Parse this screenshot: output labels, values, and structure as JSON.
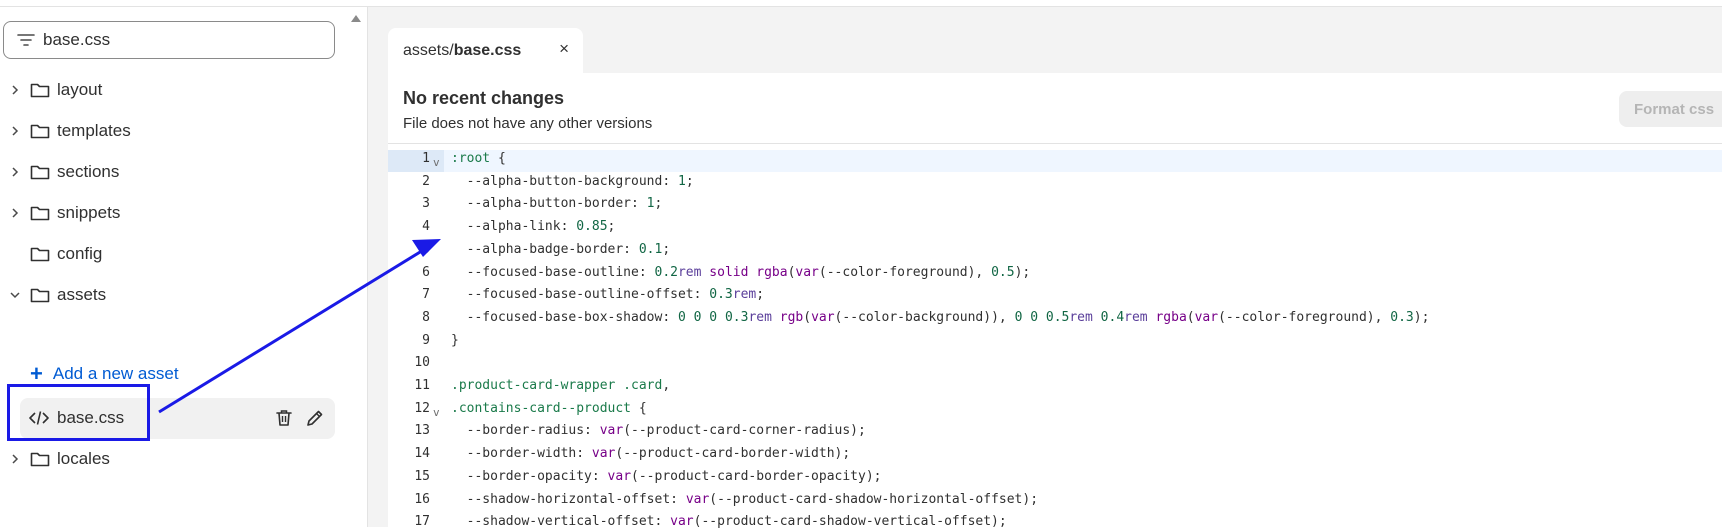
{
  "sidebar": {
    "search_value": "base.css",
    "items": [
      {
        "label": "layout",
        "expanded": false,
        "has_chevron": true
      },
      {
        "label": "templates",
        "expanded": false,
        "has_chevron": true
      },
      {
        "label": "sections",
        "expanded": false,
        "has_chevron": true
      },
      {
        "label": "snippets",
        "expanded": false,
        "has_chevron": true
      },
      {
        "label": "config",
        "expanded": false,
        "has_chevron": false
      },
      {
        "label": "assets",
        "expanded": true,
        "has_chevron": true
      }
    ],
    "add_asset_label": "Add a new asset",
    "asset_file": "base.css",
    "after_items": [
      {
        "label": "locales",
        "expanded": false,
        "has_chevron": true
      }
    ]
  },
  "tab": {
    "path": "assets/",
    "file": "base.css",
    "close": "×"
  },
  "status": {
    "title": "No recent changes",
    "subtitle": "File does not have any other versions"
  },
  "format_button": "Format css",
  "code": {
    "line_numbers": [
      "1",
      "2",
      "3",
      "4",
      "5",
      "6",
      "7",
      "8",
      "9",
      "10",
      "11",
      "12",
      "13",
      "14",
      "15",
      "16",
      "17"
    ],
    "lines": [
      ":root {",
      "  --alpha-button-background: 1;",
      "  --alpha-button-border: 1;",
      "  --alpha-link: 0.85;",
      "  --alpha-badge-border: 0.1;",
      "  --focused-base-outline: 0.2rem solid rgba(var(--color-foreground), 0.5);",
      "  --focused-base-outline-offset: 0.3rem;",
      "  --focused-base-box-shadow: 0 0 0 0.3rem rgb(var(--color-background)), 0 0 0.5rem 0.4rem rgba(var(--color-foreground), 0.3);",
      "}",
      "",
      ".product-card-wrapper .card,",
      ".contains-card--product {",
      "  --border-radius: var(--product-card-corner-radius);",
      "  --border-width: var(--product-card-border-width);",
      "  --border-opacity: var(--product-card-border-opacity);",
      "  --shadow-horizontal-offset: var(--product-card-shadow-horizontal-offset);",
      "  --shadow-vertical-offset: var(--product-card-shadow-vertical-offset);"
    ],
    "fold_markers": [
      "v",
      "v"
    ]
  },
  "colors": {
    "accent": "#005bd3",
    "annotation": "#1a1ae6",
    "active_line": "#eff6ff"
  }
}
